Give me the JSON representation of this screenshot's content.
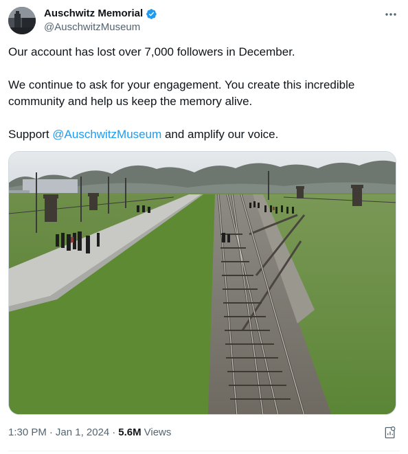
{
  "author": {
    "display_name": "Auschwitz Memorial",
    "handle": "@AuschwitzMuseum",
    "verified": true,
    "verified_color": "#1d9bf0"
  },
  "more_icon": "more-horizontal-icon",
  "tweet": {
    "line1": "Our account has lost over 7,000 followers in December.",
    "line2": "We continue to ask for your engagement. You create this incredible community and help us keep the memory alive.",
    "line3_before": "Support ",
    "line3_mention": "@AuschwitzMuseum",
    "line3_after": " and amplify our voice."
  },
  "media": {
    "description_icon": "photo-railway-tracks"
  },
  "meta": {
    "time": "1:30 PM",
    "separator": "·",
    "date": "Jan 1, 2024",
    "views_count": "5.6M",
    "views_label": "Views"
  },
  "colors": {
    "link": "#1d9bf0",
    "secondary_text": "#536471",
    "primary_text": "#0f1419"
  }
}
